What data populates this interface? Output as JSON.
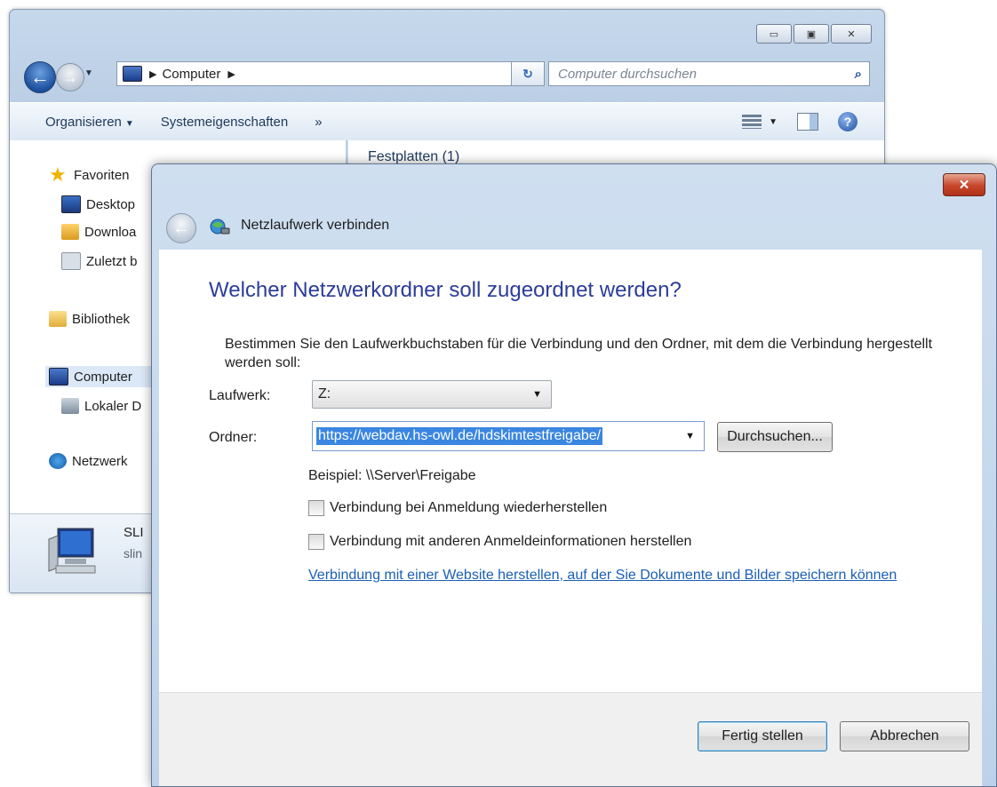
{
  "explorer": {
    "address": {
      "path": "Computer"
    },
    "search": {
      "placeholder": "Computer durchsuchen"
    },
    "toolbar": {
      "organize": "Organisieren",
      "system_properties": "Systemeigenschaften",
      "more": "»"
    },
    "nav": {
      "favorites": "Favoriten",
      "desktop": "Desktop",
      "downloads": "Downloa",
      "recent": "Zuletzt b",
      "libraries": "Bibliothek",
      "computer": "Computer",
      "local_disk": "Lokaler D",
      "network": "Netzwerk"
    },
    "content_header": "Festplatten (1)",
    "details": {
      "name": "SLI",
      "sub": "slin"
    }
  },
  "dialog": {
    "title": "Netzlaufwerk verbinden",
    "close": "✕",
    "heading": "Welcher Netzwerkordner soll zugeordnet werden?",
    "intro": "Bestimmen Sie den Laufwerkbuchstaben für die Verbindung und den Ordner, mit dem die Verbindung hergestellt werden soll:",
    "drive_label": "Laufwerk:",
    "drive_value": "Z:",
    "folder_label": "Ordner:",
    "folder_value": "https://webdav.hs-owl.de/hdskimtestfreigabe/",
    "browse_button": "Durchsuchen...",
    "example": "Beispiel: \\\\Server\\Freigabe",
    "reconnect_label": "Verbindung bei Anmeldung wiederherstellen",
    "reconnect_checked": false,
    "other_credentials_label": "Verbindung mit anderen Anmeldeinformationen herstellen",
    "other_credentials_checked": false,
    "website_link": "Verbindung mit einer Website herstellen, auf der Sie Dokumente und Bilder speichern können",
    "finish_button": "Fertig stellen",
    "cancel_button": "Abbrechen"
  }
}
